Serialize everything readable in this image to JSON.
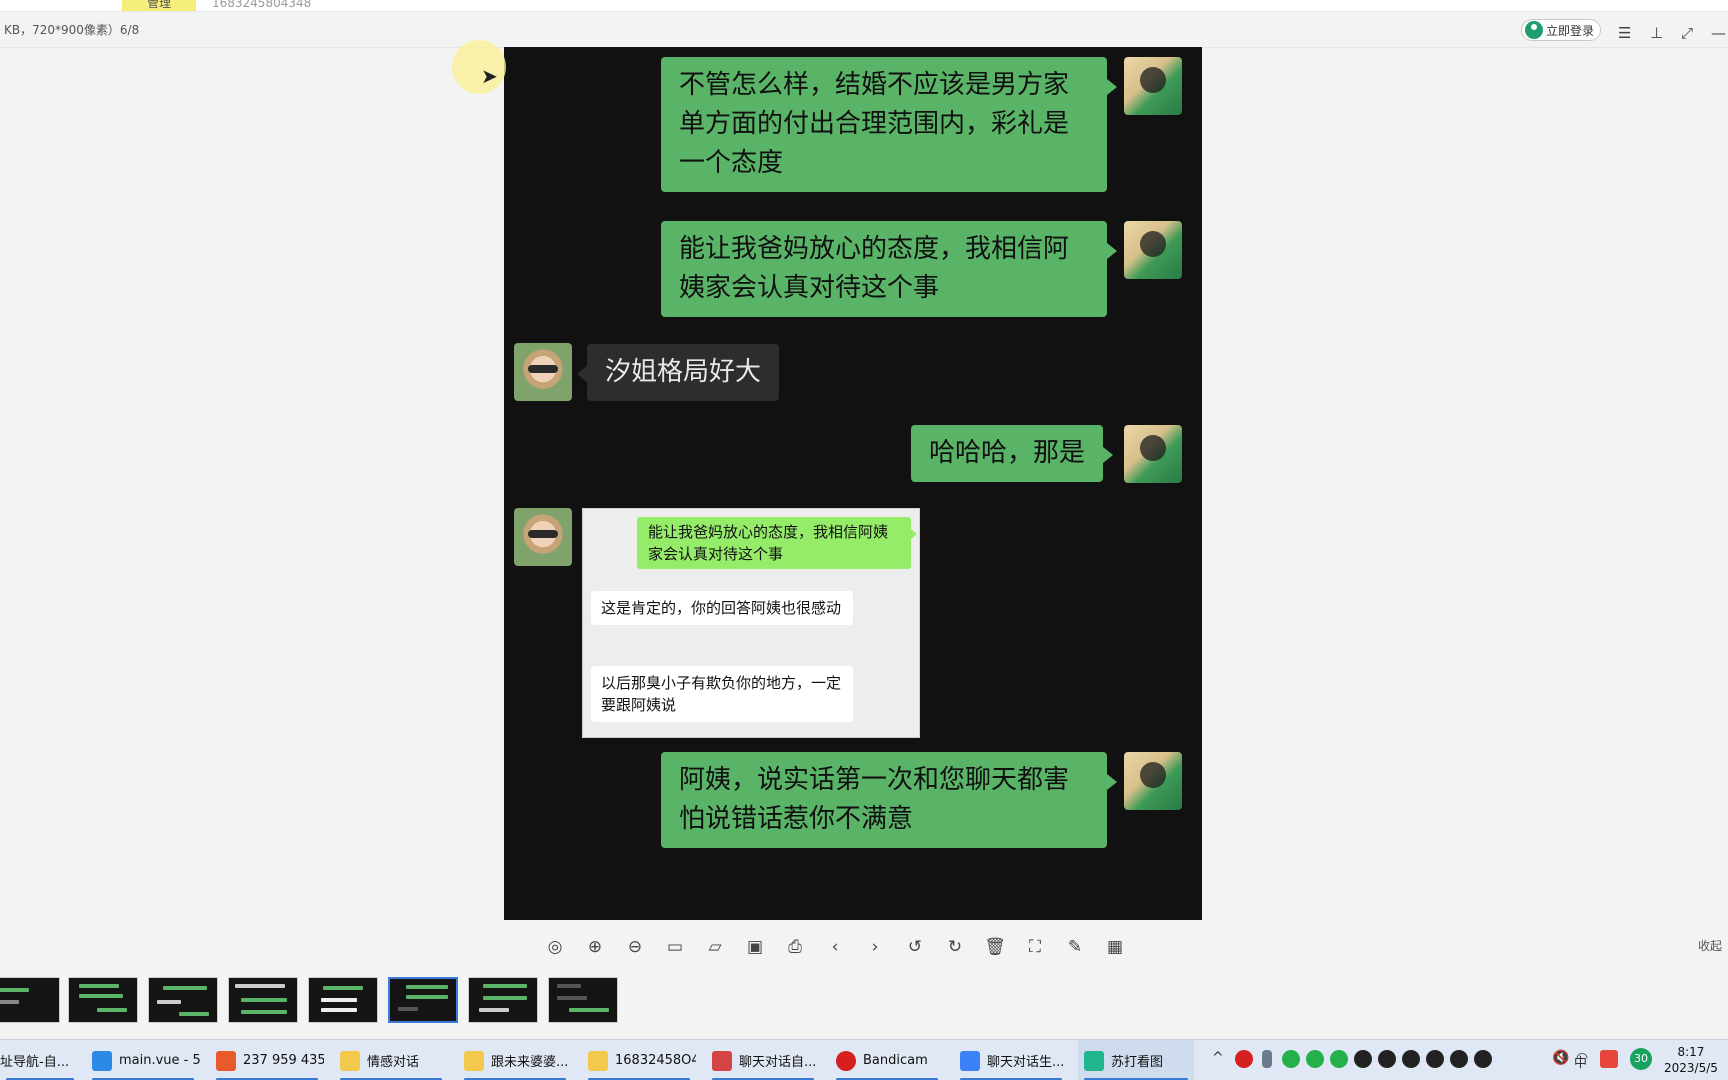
{
  "top_strip": {
    "tab_label": "管理",
    "number": "1683245804348"
  },
  "viewer": {
    "file_info": "KB，720*900像素）6/8",
    "login_label": "立即登录"
  },
  "chat": {
    "messages": [
      {
        "from": "me",
        "text": "不管怎么样，结婚不应该是男方家单方面的付出合理范围内，彩礼是一个态度"
      },
      {
        "from": "me",
        "text": "能让我爸妈放心的态度，我相信阿姨家会认真对待这个事"
      },
      {
        "from": "her",
        "text": "汐姐格局好大"
      },
      {
        "from": "me",
        "text": "哈哈哈，那是"
      },
      {
        "from": "her",
        "type": "screenshot",
        "items": [
          {
            "from": "me",
            "text": "能让我爸妈放心的态度，我相信阿姨家会认真对待这个事"
          },
          {
            "from": "her",
            "text": "这是肯定的，你的回答阿姨也很感动"
          },
          {
            "from": "her",
            "text": "以后那臭小子有欺负你的地方，一定要跟阿姨说"
          }
        ]
      },
      {
        "from": "me",
        "text": "阿姨，说实话第一次和您聊天都害怕说错话惹你不满意"
      }
    ]
  },
  "toolbar": {
    "icons": [
      "mouse-icon",
      "zoom-in-icon",
      "zoom-out-icon",
      "actual-size-icon",
      "open-folder-icon",
      "slideshow-icon",
      "print-icon",
      "prev-icon",
      "next-icon",
      "rotate-left-icon",
      "rotate-right-icon",
      "delete-icon",
      "ocr-icon",
      "edit-icon",
      "grid-icon"
    ],
    "collapse_label": "收起"
  },
  "thumbnails": {
    "count": 8,
    "active_index": 5
  },
  "taskbar": {
    "items": [
      {
        "label": "址导航-自...",
        "color": "#2f7de1"
      },
      {
        "label": "main.vue - 5...",
        "color": "#2b8ae6"
      },
      {
        "label": "237 959 435",
        "color": "#e95a2a"
      },
      {
        "label": "情感对话",
        "color": "#f2c94c"
      },
      {
        "label": "跟未来婆婆...",
        "color": "#f2c94c"
      },
      {
        "label": "16832458O4...",
        "color": "#f2c94c"
      },
      {
        "label": "聊天对话自...",
        "color": "#d64545"
      },
      {
        "label": "Bandicam",
        "color": "#d62020"
      },
      {
        "label": "聊天对话生...",
        "color": "#3b82f6"
      },
      {
        "label": "苏打看图",
        "color": "#20b58c"
      }
    ],
    "tray_badge": "30",
    "input_method": "中",
    "time": "8:17",
    "date": "2023/5/5"
  }
}
